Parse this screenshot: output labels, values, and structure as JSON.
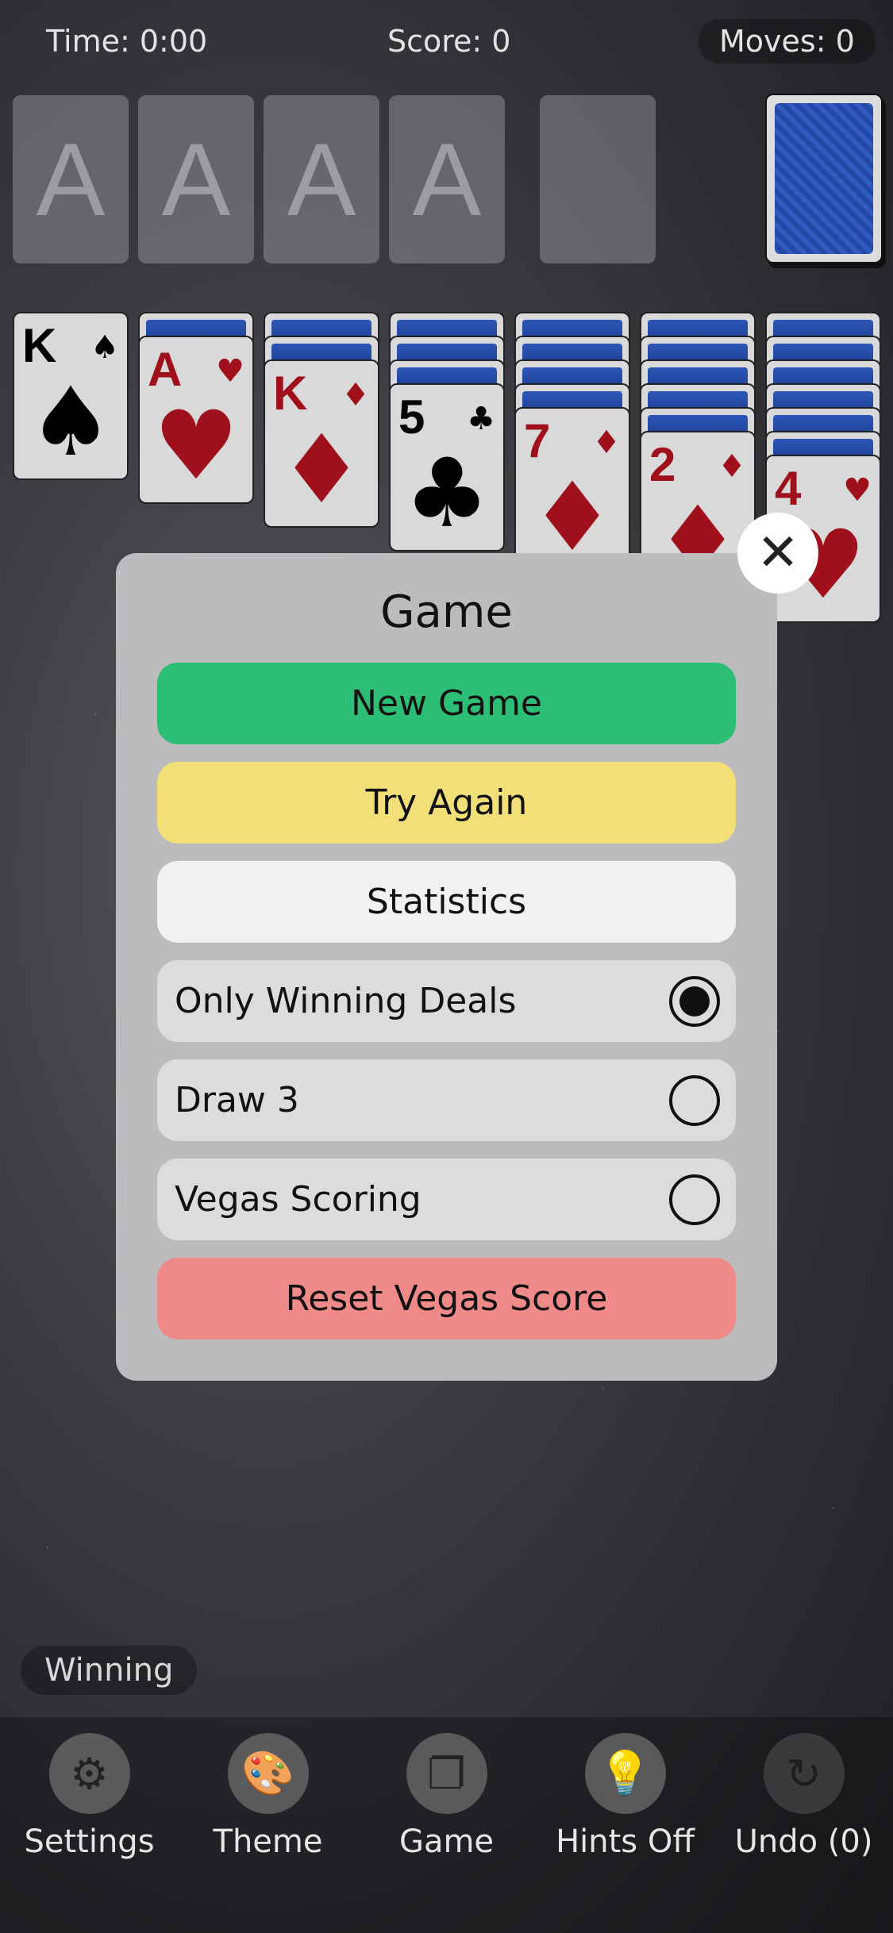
{
  "status": {
    "time": "Time: 0:00",
    "score": "Score: 0",
    "moves": "Moves: 0"
  },
  "foundations": [
    "A",
    "A",
    "A",
    "A"
  ],
  "tableau": [
    {
      "rank": "K",
      "suit": "♠",
      "color": "black"
    },
    {
      "rank": "A",
      "suit": "♥",
      "color": "red"
    },
    {
      "rank": "K",
      "suit": "♦",
      "color": "red"
    },
    {
      "rank": "5",
      "suit": "♣",
      "color": "black"
    },
    {
      "rank": "7",
      "suit": "♦",
      "color": "red"
    },
    {
      "rank": "2",
      "suit": "♦",
      "color": "red"
    },
    {
      "rank": "4",
      "suit": "♥",
      "color": "red"
    }
  ],
  "modal": {
    "title": "Game",
    "new_game": "New Game",
    "try_again": "Try Again",
    "statistics": "Statistics",
    "options": [
      {
        "label": "Only Winning Deals",
        "selected": true
      },
      {
        "label": "Draw 3",
        "selected": false
      },
      {
        "label": "Vegas Scoring",
        "selected": false
      }
    ],
    "reset_vegas": "Reset Vegas Score",
    "close_icon": "close-icon"
  },
  "badge": "Winning",
  "toolbar": [
    {
      "label": "Settings",
      "icon": "gear-icon"
    },
    {
      "label": "Theme",
      "icon": "palette-icon"
    },
    {
      "label": "Game",
      "icon": "cards-icon"
    },
    {
      "label": "Hints Off",
      "icon": "lightbulb-icon"
    },
    {
      "label": "Undo (0)",
      "icon": "undo-icon"
    }
  ],
  "colors": {
    "new_game": "#2dbe76",
    "try_again": "#f2df78",
    "statistics": "#f1f1f3",
    "reset_vegas": "#f08a88",
    "card_back": "#2b55b8",
    "red_suit": "#a0101c"
  }
}
